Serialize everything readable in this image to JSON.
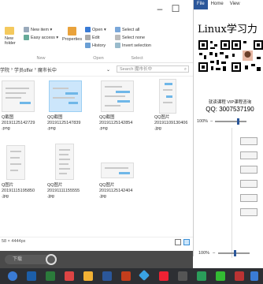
{
  "ribbon": {
    "new_folder": "New\nfolder",
    "new_item": "New item ▾",
    "easy_access": "Easy access ▾",
    "properties": "Properties",
    "open": "Open ▾",
    "edit": "Edit",
    "history": "History",
    "select_all": "Select all",
    "select_none": "Select none",
    "invert_selection": "Invert selection",
    "group_new": "New",
    "group_open": "Open",
    "group_select": "Select"
  },
  "address": {
    "crumbs": [
      "学院",
      "学员offer",
      "魔市长中"
    ],
    "search_placeholder": "Search 魔市长中"
  },
  "files": [
    {
      "name": "Q截图\n20191125142729\n.png",
      "kind": "chat"
    },
    {
      "name": "QQ截图\n20191125147839\n.png",
      "kind": "chat",
      "selected": true
    },
    {
      "name": "QQ截图\n20191125142854\n.png",
      "kind": "chat"
    },
    {
      "name": "QQ图片\n20191109130406\n.jpg",
      "kind": "phone"
    },
    {
      "name": "Q图片\n20191115195850\n.jpg",
      "kind": "phone"
    },
    {
      "name": "QQ图片\n20191111155555\n.jpg",
      "kind": "list"
    },
    {
      "name": "QQ图片\n20191125142404\n.jpg",
      "kind": "wide"
    }
  ],
  "status": {
    "dims": "58 × 4444px"
  },
  "overlay": {
    "menu": [
      "File",
      "Home",
      "View"
    ],
    "heading": "Linux学习力",
    "subtitle": "就读课程 VIP课程咨询",
    "qq": "QQ: 3007537190",
    "zoom": "100%",
    "zoom2": "100%"
  },
  "taskbar": {
    "pill_text": "下载"
  },
  "colors": {
    "accent": "#2b579a",
    "selection": "#cce6fb",
    "taskbar": "#2d2f33"
  }
}
